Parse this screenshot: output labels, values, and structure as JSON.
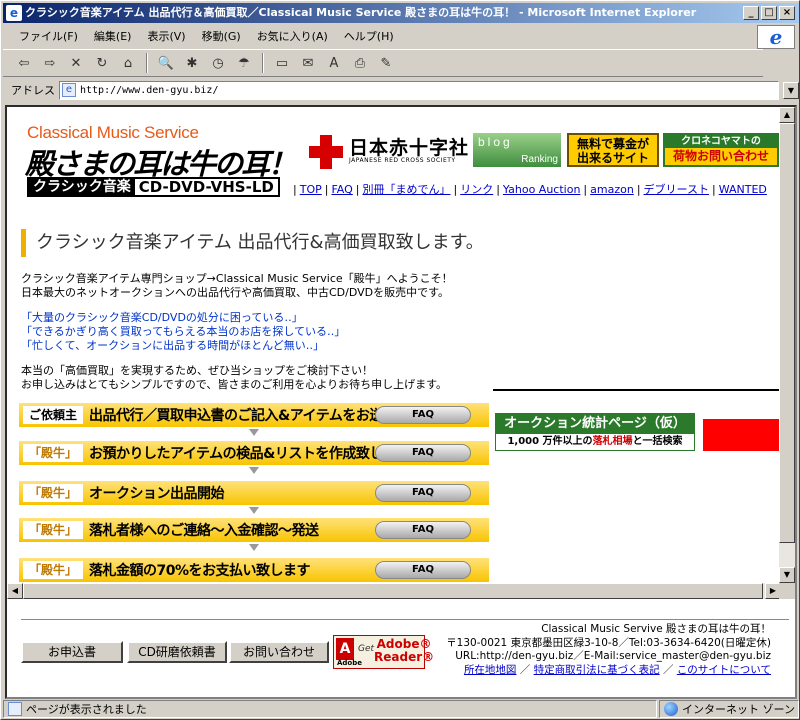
{
  "window": {
    "title": "クラシック音楽アイテム 出品代行＆高価買取／Classical Music Service 殿さまの耳は牛の耳！ - Microsoft Internet Explorer",
    "controls": [
      "_",
      "□",
      "×"
    ]
  },
  "menu": [
    "ファイル(F)",
    "編集(E)",
    "表示(V)",
    "移動(G)",
    "お気に入り(A)",
    "ヘルプ(H)"
  ],
  "toolbar": {
    "back": "⇦",
    "forward": "⇨",
    "stop": "✕",
    "refresh": "↻",
    "home": "⌂",
    "search": "🔍",
    "favorites": "✱",
    "history": "◷",
    "channels": "☂",
    "fullscreen": "▭",
    "mail": "✉",
    "font": "A",
    "print": "⎙",
    "edit": "✎"
  },
  "address": {
    "label": "アドレス",
    "url": "http://www.den-gyu.biz/"
  },
  "header": {
    "logo_en": "Classical Music Service",
    "logo_jp": "殿さまの耳は牛の耳！",
    "logo_cat_a": "クラシック音楽",
    "logo_cat_b": "CD-DVD-VHS-LD",
    "jrc_jp": "日本赤十字社",
    "jrc_en": "JAPANESE RED CROSS SOCIETY",
    "blog": "blog",
    "ranking": "Ranking",
    "donate_line1": "無料で募金が",
    "donate_line2": "出来るサイト",
    "kuroneko_top": "クロネコヤマトの",
    "kuroneko_bottom": "荷物お問い合わせ"
  },
  "nav": [
    "TOP",
    "FAQ",
    "別冊「まめでん」",
    "リンク",
    "Yahoo Auction",
    "amazon",
    "デブリースト",
    "WANTED"
  ],
  "main": {
    "heading": "クラシック音楽アイテム 出品代行&高価買取致します。",
    "intro1": "クラシック音楽アイテム専門ショップ→Classical Music Service「殿牛」へようこそ！",
    "intro2": "日本最大のネットオークションへの出品代行や高価買取、中古CD/DVDを販売中です。",
    "quote1": "「大量のクラシック音楽CD/DVDの処分に困っている‥」",
    "quote2": "「できるかぎり高く買取ってもらえる本当のお店を探している‥」",
    "quote3": "「忙しくて、オークションに出品する時間がほとんど無い‥」",
    "req1": "本当の「高価買取」を実現するため、ぜひ当ショップをご検討下さい！",
    "req2": "お申し込みはとてもシンプルですので、皆さまのご利用を心よりお待ち申し上げます。",
    "steps": [
      {
        "label": "ご依頼主",
        "text": "出品代行／買取申込書のご記入&アイテムをお送り下さい",
        "faq": "FAQ"
      },
      {
        "label": "「殿牛」",
        "text": "お預かりしたアイテムの検品&リストを作成致します",
        "faq": "FAQ"
      },
      {
        "label": "「殿牛」",
        "text": "オークション出品開始",
        "faq": "FAQ"
      },
      {
        "label": "「殿牛」",
        "text": "落札者様へのご連絡～入金確認～発送",
        "faq": "FAQ"
      },
      {
        "label": "「殿牛」",
        "text": "落札金額の70%をお支払い致します",
        "faq": "FAQ"
      }
    ],
    "auction_title": "オークション統計ページ（仮）",
    "auction_sub_a": "1,000 万件以上の",
    "auction_sub_b": "落札相場",
    "auction_sub_c": "と一括検索"
  },
  "footer": {
    "btn_apply": "お申込書",
    "btn_cd": "CD研磨依頼書",
    "btn_contact": "お問い合わせ",
    "adobe_get": "Get",
    "adobe_reader1": "Adobe®",
    "adobe_reader2": "Reader®",
    "adobe_small": "Adobe",
    "info1": "Classical Music Servive 殿さまの耳は牛の耳！",
    "info2": "〒130-0021 東京都墨田区緑3-10-8／Tel:03-3634-6420(日曜定休)",
    "info3": "URL:http://den-gyu.biz／E-Mail:service_master@den-gyu.biz",
    "link_map": "所在地地図",
    "link_law": "特定商取引法に基づく表記",
    "link_about": "このサイトについて"
  },
  "status": {
    "text": "ページが表示されました",
    "zone": "インターネット ゾーン"
  },
  "colors": {
    "accent": "#f8c400",
    "titlebar": "#0a246a",
    "link": "#0000cc",
    "redcross": "#d70000"
  }
}
